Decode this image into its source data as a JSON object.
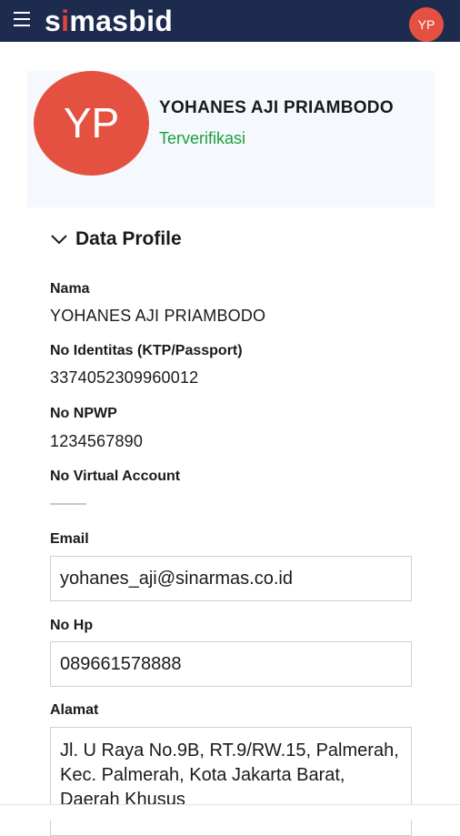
{
  "header": {
    "logo_prefix": "s",
    "logo_accent": "i",
    "logo_suffix": "masbid",
    "avatar_initials": "YP"
  },
  "profile": {
    "initials": "YP",
    "name": "YOHANES AJI PRIAMBODO",
    "status": "Terverifikasi"
  },
  "section": {
    "title": "Data Profile"
  },
  "fields": {
    "nama": {
      "label": "Nama",
      "value": "YOHANES AJI PRIAMBODO"
    },
    "identitas": {
      "label": "No Identitas (KTP/Passport)",
      "value": "3374052309960012"
    },
    "npwp": {
      "label": "No NPWP",
      "value": "1234567890"
    },
    "virtual_account": {
      "label": "No Virtual Account",
      "value": ""
    },
    "email": {
      "label": "Email",
      "value": "yohanes_aji@sinarmas.co.id"
    },
    "hp": {
      "label": "No Hp",
      "value": "089661578888"
    },
    "alamat": {
      "label": "Alamat",
      "value": "Jl. U Raya No.9B, RT.9/RW.15, Palmerah, Kec. Palmerah, Kota Jakarta Barat, Daerah Khusus"
    }
  },
  "colors": {
    "topbar": "#1c2b4e",
    "avatar": "#e55140",
    "verified": "#1e9e3a"
  }
}
